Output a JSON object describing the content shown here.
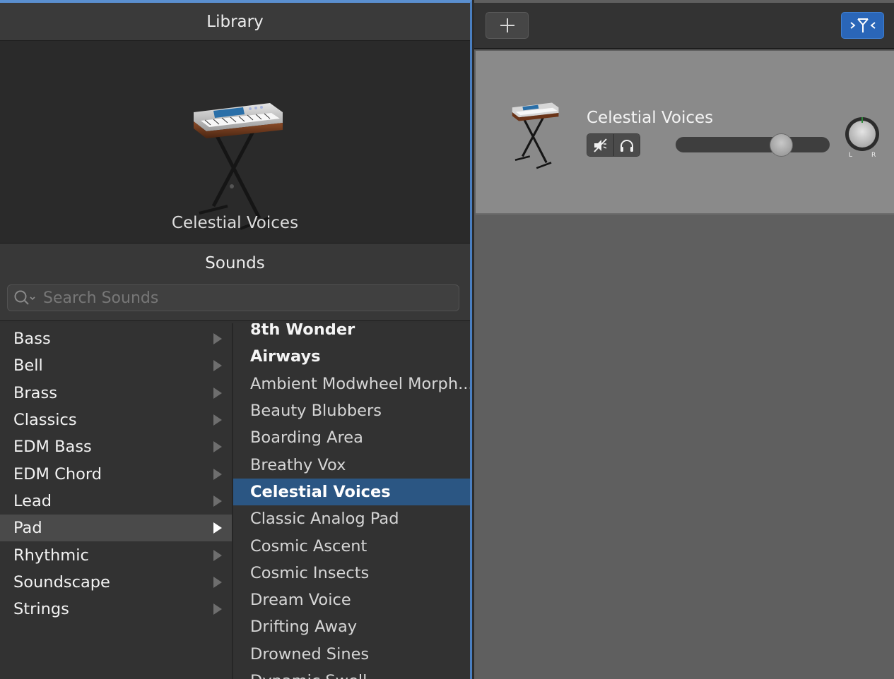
{
  "library": {
    "title": "Library",
    "preview_name": "Celestial Voices",
    "instrument_icon": "keyboard-on-stand-icon"
  },
  "sounds": {
    "title": "Sounds",
    "search_placeholder": "Search Sounds",
    "categories": [
      {
        "label": "Bass"
      },
      {
        "label": "Bell"
      },
      {
        "label": "Brass"
      },
      {
        "label": "Classics"
      },
      {
        "label": "EDM Bass"
      },
      {
        "label": "EDM Chord"
      },
      {
        "label": "Lead"
      },
      {
        "label": "Pad",
        "selected": true
      },
      {
        "label": "Rhythmic"
      },
      {
        "label": "Soundscape"
      },
      {
        "label": "Strings"
      }
    ],
    "patches": [
      {
        "label": "8th Wonder",
        "strong": true
      },
      {
        "label": "Airways",
        "strong": true
      },
      {
        "label": "Ambient Modwheel Morph..."
      },
      {
        "label": "Beauty Blubbers"
      },
      {
        "label": "Boarding Area"
      },
      {
        "label": "Breathy Vox"
      },
      {
        "label": "Celestial Voices",
        "selected": true
      },
      {
        "label": "Classic Analog Pad"
      },
      {
        "label": "Cosmic Ascent"
      },
      {
        "label": "Cosmic Insects"
      },
      {
        "label": "Dream Voice"
      },
      {
        "label": "Drifting Away"
      },
      {
        "label": "Drowned Sines"
      },
      {
        "label": "Dynamic Swell"
      }
    ]
  },
  "tracks": {
    "add_label": "+",
    "smart_controls_icon": ">Y<",
    "track": {
      "name": "Celestial Voices",
      "mute_icon": "speaker-mute-icon",
      "solo_icon": "headphones-icon",
      "volume": 0.72,
      "pan_left": "L",
      "pan_right": "R"
    }
  },
  "colors": {
    "accent": "#2b5683",
    "smart_button": "#2a66b8",
    "focus_border": "#4a7fc1"
  }
}
